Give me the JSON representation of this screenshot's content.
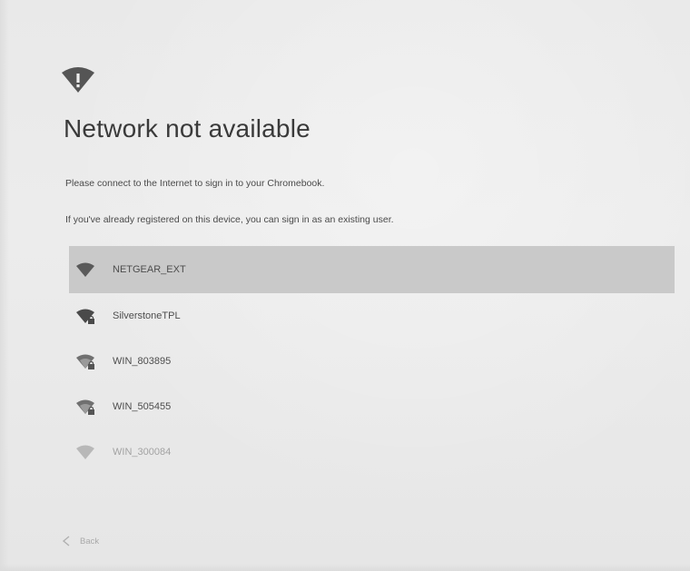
{
  "header": {
    "icon": "wifi-alert-icon",
    "title": "Network not available"
  },
  "instructions": {
    "line1": "Please connect to the Internet to sign in to your Chromebook.",
    "line2": "If you've already registered on this device, you can sign in as an existing user."
  },
  "networks": [
    {
      "name": "NETGEAR_EXT",
      "icon": "wifi-icon",
      "secured": false,
      "selected": true
    },
    {
      "name": "SilverstoneTPL",
      "icon": "wifi-lock-icon",
      "secured": true,
      "selected": false
    },
    {
      "name": "WIN_803895",
      "icon": "wifi-lock-icon",
      "secured": true,
      "selected": false
    },
    {
      "name": "WIN_505455",
      "icon": "wifi-lock-icon",
      "secured": true,
      "selected": false
    },
    {
      "name": "WIN_300084",
      "icon": "wifi-icon",
      "secured": false,
      "selected": false
    }
  ],
  "footer": {
    "back_label": "Back",
    "back_icon": "chevron-left-icon"
  },
  "colors": {
    "selected_row": "#c9c9c9",
    "icon": "#555555",
    "title_text": "#3a3a3a"
  }
}
